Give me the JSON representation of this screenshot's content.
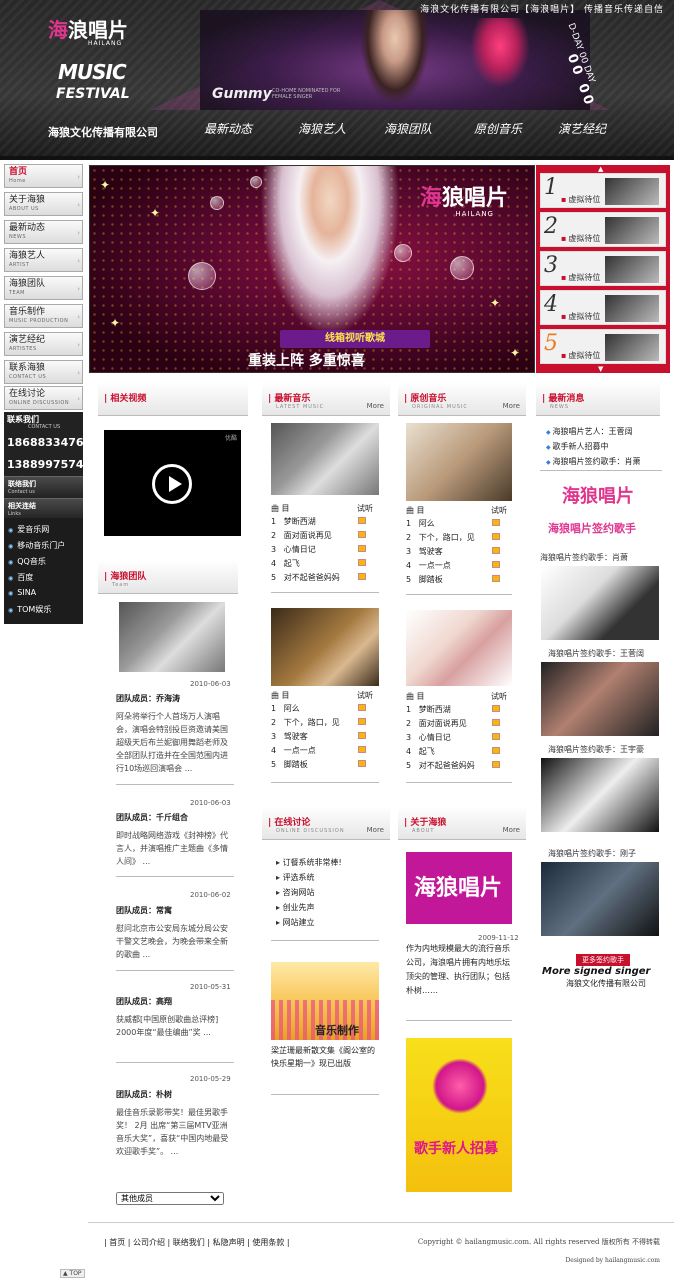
{
  "header": {
    "slogan": "海浪文化传播有限公司【海浪唱片】 传播音乐传递自信",
    "logo_cn_1": "海",
    "logo_cn_2": "浪唱片",
    "logo_sub": "HAILANG",
    "logo_music": "MUSIC",
    "logo_festival": "FESTIVAL",
    "gummy": "Gummy",
    "gummy_sub": "CO-HOME NOMINATED FOR FEMALE SINGER",
    "dday": "D-DAY 00 DAY",
    "countdown": "00 00",
    "company": "海狼文化传播有限公司",
    "nav": [
      "最新动态",
      "海狼艺人",
      "海狼团队",
      "原创音乐",
      "演艺经纪"
    ]
  },
  "sidebar": {
    "menu": [
      {
        "cn": "首页",
        "en": "Home"
      },
      {
        "cn": "关于海狼",
        "en": "ABOUT US"
      },
      {
        "cn": "最新动态",
        "en": "NEWS"
      },
      {
        "cn": "海狼艺人",
        "en": "ARTIST"
      },
      {
        "cn": "海狼团队",
        "en": "TEAM"
      },
      {
        "cn": "音乐制作",
        "en": "MUSIC PRODUCTION"
      },
      {
        "cn": "演艺经纪",
        "en": "ARTISTES"
      },
      {
        "cn": "联系海狼",
        "en": "CONTACT US"
      },
      {
        "cn": "在线讨论",
        "en": "ONLINE DISCUSSION"
      }
    ],
    "contact_head": "联系我们",
    "contact_head_en": "CONTACT US",
    "phones": [
      "18688334767",
      "13889975742"
    ],
    "contact2_cn": "联络我们",
    "contact2_en": "Contact us",
    "links_cn": "相关连结",
    "links_en": "Links",
    "links": [
      "爱音乐网",
      "移动音乐门户",
      "QQ音乐",
      "百度",
      "SINA",
      "TOM娱乐"
    ]
  },
  "banner": {
    "logo_1": "海",
    "logo_2": "狼唱片",
    "logo_sub": "HAILANG",
    "ribbon": "线箱视听歌城",
    "main": "重装上阵 多重惊喜"
  },
  "artists": {
    "items": [
      {
        "num": "1",
        "label": "虚拟待位"
      },
      {
        "num": "2",
        "label": "虚拟待位"
      },
      {
        "num": "3",
        "label": "虚拟待位"
      },
      {
        "num": "4",
        "label": "虚拟待位"
      },
      {
        "num": "5",
        "label": "虚拟待位"
      }
    ]
  },
  "video": {
    "title": "相关视频",
    "tag": "优酷"
  },
  "team": {
    "title": "海狼团队",
    "en": "Team",
    "members": [
      {
        "date": "2010-06-03",
        "name": "团队成员：乔海涛",
        "desc": "阿朵将举行个人首场万人演唱会，演唱会特别投巨资邀请美国超级天后布兰妮御用舞蹈老师及全部团队打造并在全国范围内进行10场巡回演唱会 ..."
      },
      {
        "date": "2010-06-03",
        "name": "团队成员：千斤组合",
        "desc": "即时战略网络游戏《封神榜》代言人，并演唱推广主题曲《多情人间》 ..."
      },
      {
        "date": "2010-06-02",
        "name": "团队成员：常寓",
        "desc": "慰问北京市公安局东城分局公安干警文艺晚会，为晚会带来全新的歌曲 ..."
      },
      {
        "date": "2010-05-31",
        "name": "团队成员：高翔",
        "desc": "获威都[中国原创歌曲总评榜] 2000年度“最佳编曲”奖 ..."
      },
      {
        "date": "2010-05-29",
        "name": "团队成员：朴树",
        "desc": "最佳音乐录影带奖！最佳男歌手奖！ 2月 出席“第三届MTV亚洲音乐大奖”，喜获“中国内地最受欢迎歌手奖”。 ..."
      }
    ],
    "select": "其他成员"
  },
  "latest_music": {
    "title": "最新音乐",
    "en": "LATEST MUSIC",
    "more": "More",
    "head_name": "曲 目",
    "head_play": "试听",
    "list1": [
      "梦断西湖",
      "面对面说再见",
      "心情日记",
      "起飞",
      "对不起爸爸妈妈"
    ],
    "list2": [
      "阿么",
      "下个，路口，见",
      "驾驶客",
      "一点一点",
      "脚踏板"
    ]
  },
  "original_music": {
    "title": "原创音乐",
    "en": "ORIGINAL MUSIC",
    "more": "More",
    "head_name": "曲 目",
    "head_play": "试听",
    "list1": [
      "阿么",
      "下个，路口，见",
      "驾驶客",
      "一点一点",
      "脚踏板"
    ],
    "list2": [
      "梦断西湖",
      "面对面说再见",
      "心情日记",
      "起飞",
      "对不起爸爸妈妈"
    ]
  },
  "discussion": {
    "title": "在线讨论",
    "en": "ONLINE DISCUSSION",
    "more": "More",
    "items": [
      "订餐系统非常棒!",
      "评选系统",
      "咨询网站",
      "创业先声",
      "网站建立"
    ],
    "poster_text": "音乐制作",
    "caption": "梁芷珊最新散文集《阁公室的快乐星期一》现已出版"
  },
  "about": {
    "title": "关于海狼",
    "en": "ABOUT",
    "more": "More",
    "logo_1": "海",
    "logo_2": "狼唱片",
    "date": "2009-11-12",
    "desc": "作为内地规模最大的流行音乐公司，海浪唱片拥有内地乐坛顶尖的管理、执行团队；包括朴树……",
    "poster_main": "歌手新人招募"
  },
  "news": {
    "title": "最新消息",
    "en": "NEWS",
    "items": [
      "海狼唱片艺人：王菅阔",
      "歌手新人招募中",
      "海狼唱片签约歌手：肖萧"
    ],
    "logo_1": "海",
    "logo_2": "狼唱片",
    "sign_title": "海狼唱片签约歌手",
    "singers": [
      "海狼唱片签约歌手：肖萧",
      "海狼唱片签约歌手：王菅阔",
      "海狼唱片签约歌手：王宇豪",
      "海狼唱片签约歌手：刚子"
    ],
    "more_badge": "更多签约歌手",
    "more_en": "More signed singer",
    "more_company": "海狼文化传播有限公司"
  },
  "footer": {
    "nav": "| 首页 | 公司介绍 | 联络我们 | 私隐声明 | 使用条款 |",
    "copy": "Copyright © hailangmusic.com. All rights reserved 版权所有 不得转载",
    "design": "Designed by hailangmusic.com",
    "totop": "TOP"
  }
}
